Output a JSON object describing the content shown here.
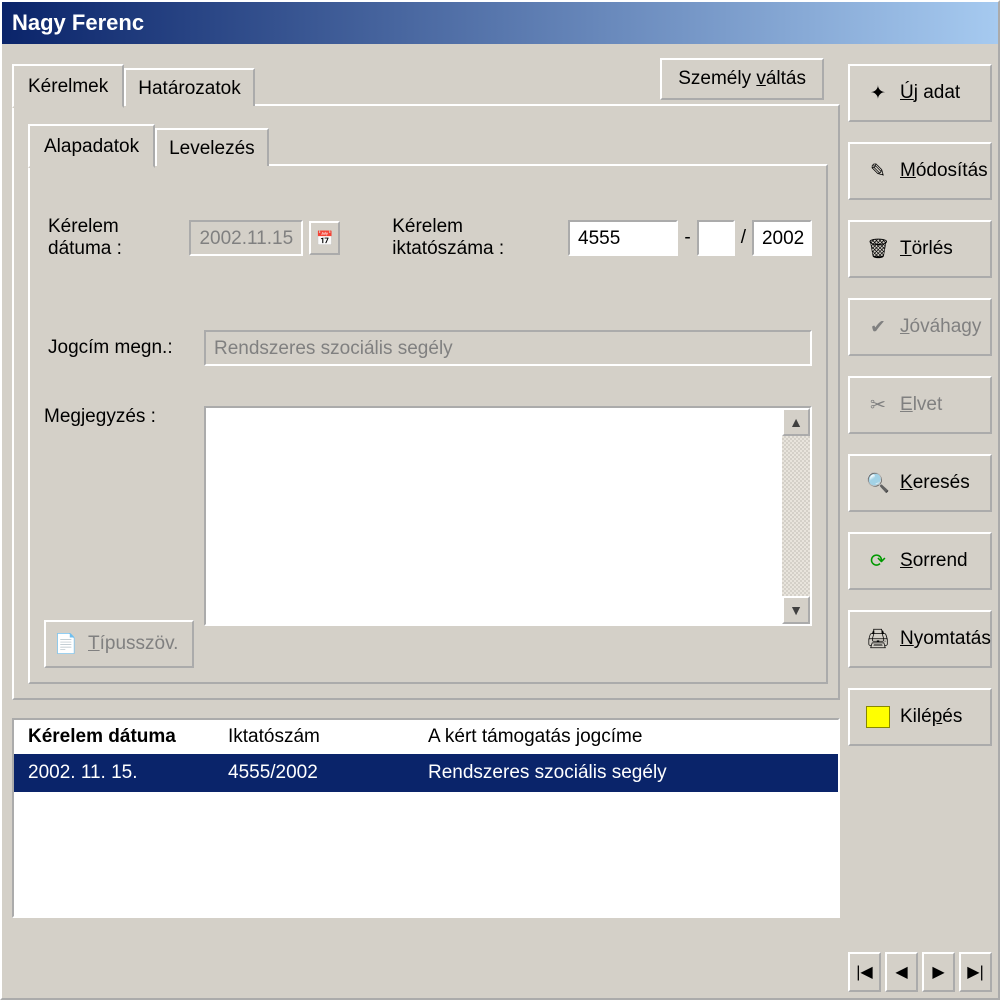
{
  "window": {
    "title": "Nagy Ferenc"
  },
  "tabs_outer": {
    "kerelmek": "Kérelmek",
    "hatarozatok": "Határozatok"
  },
  "person_switch": "Személy váltás",
  "tabs_inner": {
    "alapadatok": "Alapadatok",
    "levelezes": "Levelezés"
  },
  "form": {
    "date_label": "Kérelem dátuma :",
    "date_value": "2002.11.15",
    "regnum_label": "Kérelem iktatószáma :",
    "regnum_main": "4555",
    "regnum_dash": "-",
    "regnum_slash": "/",
    "regnum_sub": "",
    "regnum_year": "2002",
    "jogcim_label": "Jogcím megn.:",
    "jogcim_value": "Rendszeres szociális segély",
    "note_label": "Megjegyzés :",
    "tipusszov": "Típusszöv."
  },
  "grid": {
    "headers": {
      "date": "Kérelem dátuma",
      "reg": "Iktatószám",
      "title": "A kért támogatás jogcíme"
    },
    "rows": [
      {
        "date": "2002. 11. 15.",
        "reg": "4555/2002",
        "title": "Rendszeres szociális segély"
      }
    ]
  },
  "sidebar": {
    "new": "Új adat",
    "modify": "Módosítás",
    "delete": "Törlés",
    "approve": "Jóváhagy",
    "reject": "Elvet",
    "search": "Keresés",
    "sort": "Sorrend",
    "print": "Nyomtatás",
    "exit": "Kilépés"
  }
}
